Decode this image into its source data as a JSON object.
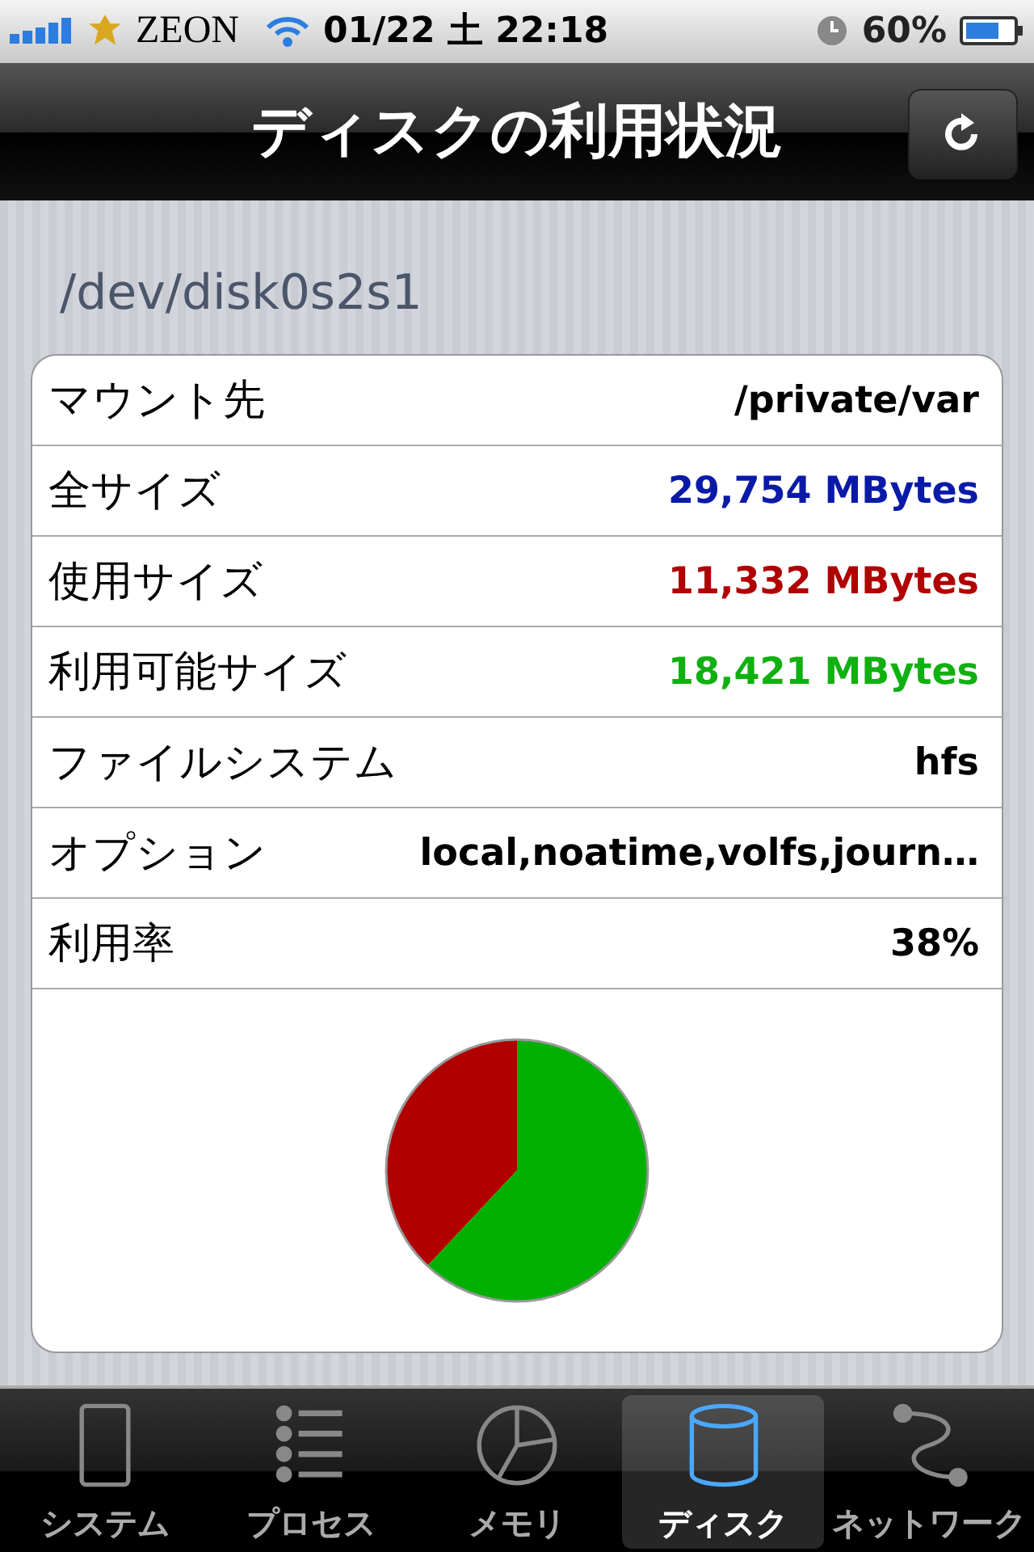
{
  "status_bar": {
    "carrier": "ZEON",
    "time": "01/22 土 22:18",
    "battery": "60%"
  },
  "nav_bar": {
    "title": "ディスクの利用状況"
  },
  "device": {
    "name": "/dev/disk0s2s1"
  },
  "rows": [
    {
      "label": "マウント先",
      "value": "/private/var",
      "color": "#000000"
    },
    {
      "label": "全サイズ",
      "value": "29,754 MBytes",
      "color": "#0a1aa8"
    },
    {
      "label": "使用サイズ",
      "value": "11,332 MBytes",
      "color": "#b00000"
    },
    {
      "label": "利用可能サイズ",
      "value": "18,421 MBytes",
      "color": "#10b010"
    },
    {
      "label": "ファイルシステム",
      "value": "hfs",
      "color": "#000000"
    },
    {
      "label": "オプション",
      "value": "local,noatime,volfs,journ…",
      "color": "#000000"
    },
    {
      "label": "利用率",
      "value": "38%",
      "color": "#000000"
    }
  ],
  "tabs": [
    {
      "label": "システム",
      "kind": "system",
      "selected": false
    },
    {
      "label": "プロセス",
      "kind": "process",
      "selected": false
    },
    {
      "label": "メモリ",
      "kind": "memory",
      "selected": false
    },
    {
      "label": "ディスク",
      "kind": "disk",
      "selected": true
    },
    {
      "label": "ネットワーク",
      "kind": "network",
      "selected": false
    }
  ]
}
